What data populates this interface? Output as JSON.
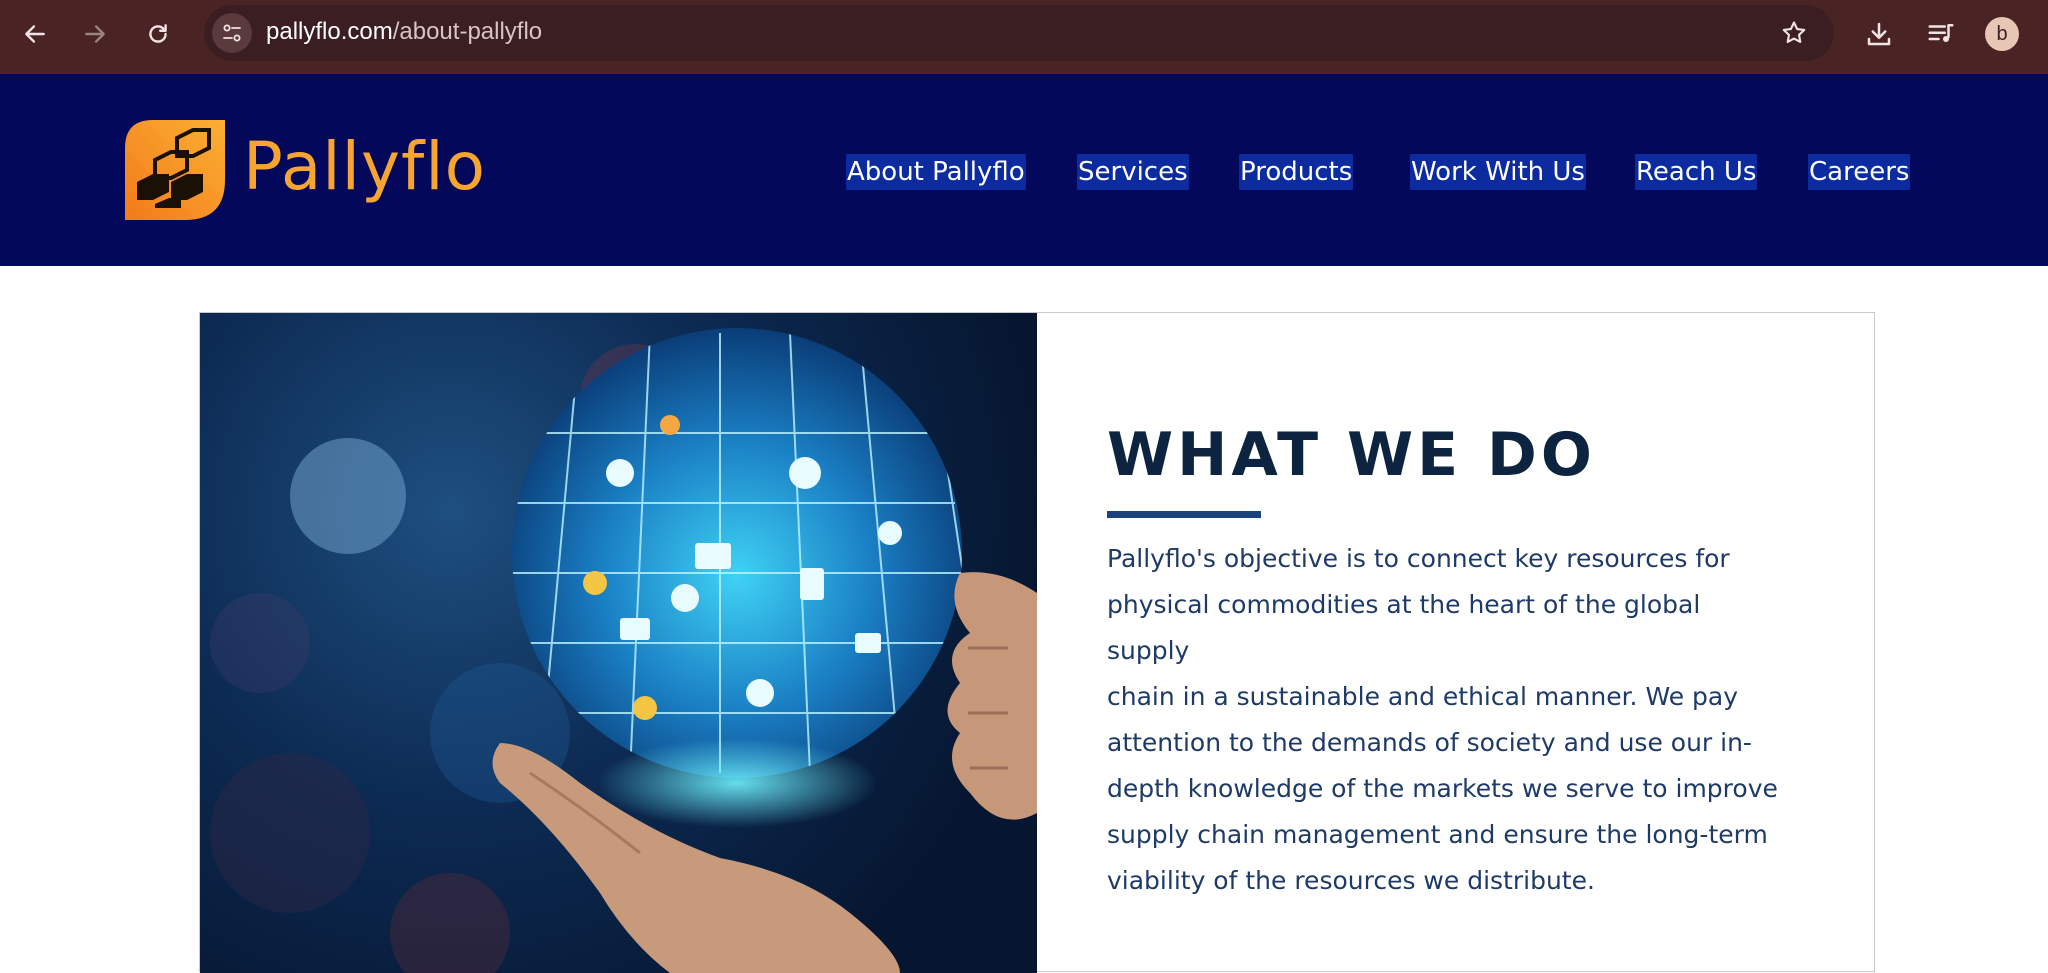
{
  "browser": {
    "url_host": "pallyflo.com",
    "url_path": "/about-pallyflo",
    "profile_initial": "b",
    "icons": [
      "back-icon",
      "forward-icon",
      "reload-icon",
      "site-info-icon",
      "star-icon",
      "download-icon",
      "media-queue-icon"
    ]
  },
  "header": {
    "brand": "Pallyflo",
    "nav": [
      {
        "label": "About Pallyflo"
      },
      {
        "label": "Services"
      },
      {
        "label": "Products"
      },
      {
        "label": "Work With Us"
      },
      {
        "label": "Reach Us"
      },
      {
        "label": "Careers"
      }
    ]
  },
  "about": {
    "heading": "WHAT WE DO",
    "lines": [
      "Pallyflo's objective is to connect key resources for",
      "physical commodities at the heart of the global supply",
      "chain in a sustainable and ethical manner. We pay",
      "attention to the demands of society and use our in-",
      "depth knowledge of the markets we serve to improve",
      "supply chain management and ensure the long-term",
      "viability of the resources we distribute."
    ]
  },
  "colors": {
    "chrome": "#4a2424",
    "header_bg": "#03085a",
    "brand_orange": "#f7a531",
    "nav_highlight": "#0b2b9e",
    "heading": "#0d2440",
    "rule": "#1b4380",
    "body_text": "#1e3a66"
  }
}
